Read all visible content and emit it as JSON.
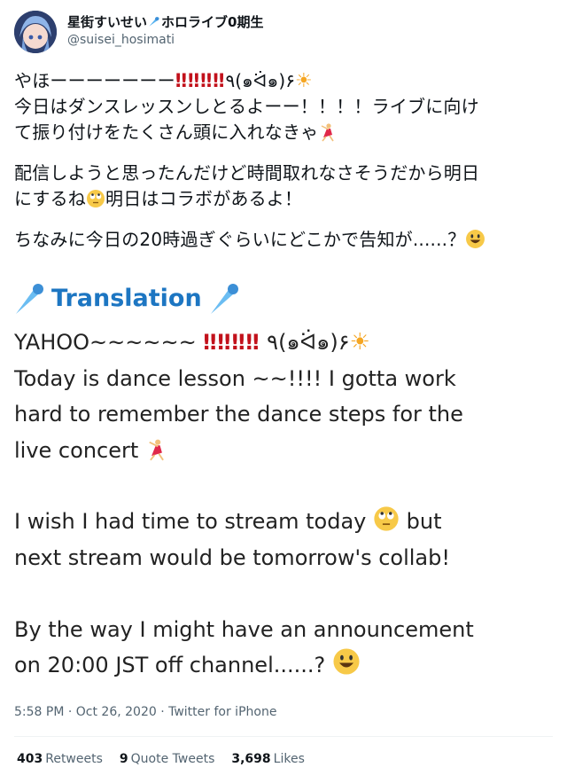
{
  "author": {
    "display_name": "星街すいせい☄️ホロライブ0期生",
    "name_prefix": "星街すいせい",
    "name_suffix": "ホロライブ0期生",
    "handle": "@suisei_hosimati"
  },
  "tweet": {
    "line1_text": "やほーーーーーーー",
    "bangs": "‼‼‼‼",
    "kaomoji": "٩(๑ᐛ๑)۶",
    "line2": "今日はダンスレッスンしとるよーー！！！！ライブに向け",
    "line3": "て振り付けをたくさん頭に入れなきゃ",
    "line4": "配信しようと思ったんだけど時間取れなさそうだから明日",
    "line5_a": "にするね",
    "line5_b": "明日はコラボがあるよ！",
    "line6": "ちなみに今日の20時過ぎぐらいにどこかで告知が......？"
  },
  "translation": {
    "heading": "Translation",
    "yahoo": "YAHOO~~~~~~",
    "kaomoji": "٩(๑ᐛ๑)۶",
    "p1_line1": "Today is dance lesson ~~!!!! I gotta work",
    "p1_line2": "hard to remember the dance steps for the",
    "p1_line3": "live concert",
    "p2_line1_a": "I wish I had time to stream today",
    "p2_line1_b": "but",
    "p2_line2": "next stream would be tomorrow's collab!",
    "p3_line1": "By the way I might have an announcement",
    "p3_line2": "on 20:00 JST off channel......?"
  },
  "meta": {
    "timestamp": "5:58 PM · Oct 26, 2020 · Twitter for iPhone"
  },
  "stats": {
    "retweets_count": "403",
    "retweets_label": "Retweets",
    "quotes_count": "9",
    "quotes_label": "Quote Tweets",
    "likes_count": "3,698",
    "likes_label": "Likes"
  },
  "icons": [
    "comet-icon",
    "dancer-emoji",
    "sun-emoji",
    "rolling-eyes-emoji",
    "smile-emoji"
  ]
}
